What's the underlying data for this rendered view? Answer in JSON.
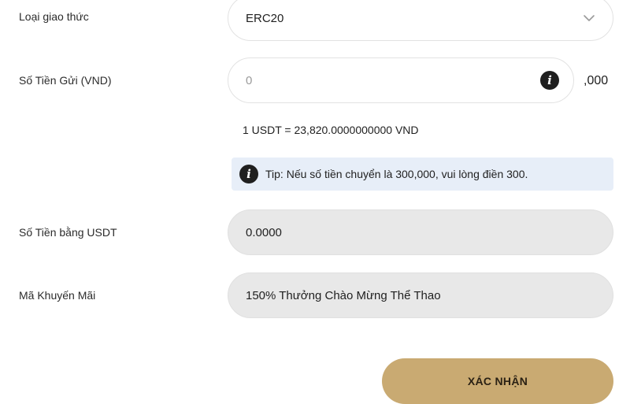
{
  "form": {
    "protocol": {
      "label": "Loại giao thức",
      "value": "ERC20",
      "icon": "chevron-down-icon"
    },
    "deposit_amount": {
      "label": "Số Tiền Gửi (VND)",
      "placeholder": "0",
      "value": "",
      "suffix": ",000",
      "icon": "info-icon"
    },
    "exchange_rate": "1 USDT = 23,820.0000000000 VND",
    "tip": {
      "text": "Tip: Nếu số tiền chuyển là 300,000, vui lòng điền 300.",
      "icon": "info-icon",
      "background": "#e7eef8"
    },
    "usdt_amount": {
      "label": "Số Tiền bằng USDT",
      "value": "0.0000"
    },
    "promo_code": {
      "label": "Mã Khuyến Mãi",
      "value": "150% Thưởng Chào Mừng Thể Thao"
    },
    "confirm_button": {
      "label": "XÁC NHẬN",
      "color": "#c9aa72"
    }
  }
}
